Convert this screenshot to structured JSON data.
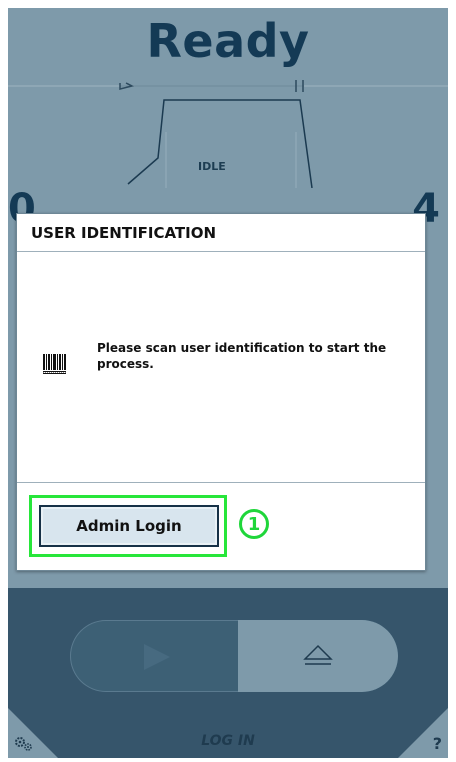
{
  "header": {
    "status_title": "Ready",
    "state_label": "IDLE",
    "left_value": "0",
    "right_value": "4"
  },
  "dialog": {
    "title": "USER IDENTIFICATION",
    "message": "Please scan user identification to start the process.",
    "admin_button_label": "Admin Login",
    "step_marker": "1"
  },
  "footer": {
    "action_label": "LOG IN",
    "help_label": "?"
  },
  "icons": {
    "barcode": "barcode-icon",
    "play": "play-icon",
    "eject": "eject-icon",
    "settings": "gear-icon"
  },
  "colors": {
    "background": "#7e9aaa",
    "dark_panel": "#36556b",
    "highlight_green": "#27e63a",
    "title_text": "#143a55"
  }
}
